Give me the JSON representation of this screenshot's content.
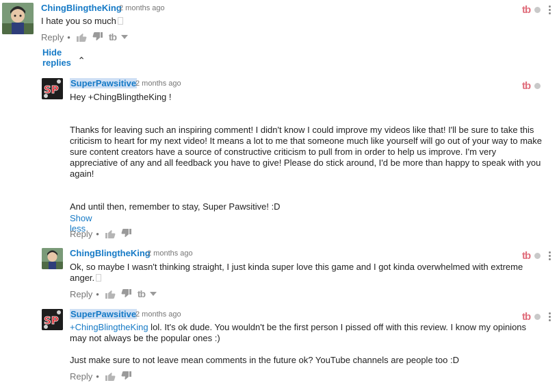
{
  "comments": [
    {
      "author": "ChingBlingtheKing",
      "time": "2 months ago",
      "text": "I hate you so much",
      "reply_label": "Reply",
      "separator": "•",
      "hide_replies_label": "Hide replies",
      "show_dislike_extension": true
    },
    {
      "author": "SuperPawsitive",
      "time": "2 months ago",
      "greeting": "Hey +ChingBlingtheKing !",
      "paragraph": "Thanks for leaving such an inspiring comment! I didn't know I could improve my videos like that! I'll be sure to take this criticism to heart for my next video! It means a lot to me that someone much like yourself will go out of your way to make sure content creators have a source of constructive criticism to pull from in order to help us improve. I'm very appreciative of any and all feedback you have to give! Please do stick around, I'd be more than happy to speak with you again!",
      "closing": "And until then, remember to stay, Super Pawsitive! :D",
      "show_less_label": "Show less",
      "reply_label": "Reply",
      "separator": "•"
    },
    {
      "author": "ChingBlingtheKing",
      "time": "2 months ago",
      "text": "Ok, so maybe I wasn't thinking straight, I just kinda super love this game and I got kinda overwhelmed with extreme anger.",
      "reply_label": "Reply",
      "separator": "•"
    },
    {
      "author": "SuperPawsitive",
      "time": "2 months ago",
      "mention": "+ChingBlingtheKing",
      "text_after_mention": " lol. It's ok dude. You wouldn't be the first person I pissed off with this review. I know my opinions may not always be the popular ones :)",
      "paragraph2": "Just make sure to not leave mean comments in the future ok? YouTube channels are people too :D",
      "reply_label": "Reply",
      "separator": "•"
    }
  ],
  "extension_mark": "tb",
  "avatar_sp_label": "SP",
  "colors": {
    "link": "#167ac6",
    "muted": "#767676",
    "ext_mark": "#e06d7b",
    "highlight": "#cfe0f5"
  }
}
